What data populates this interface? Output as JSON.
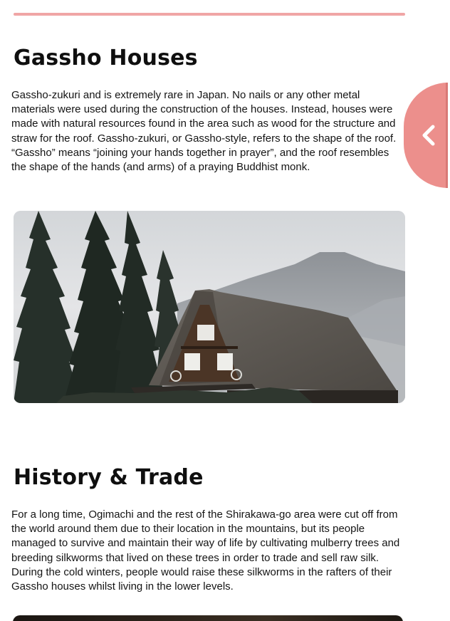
{
  "sections": [
    {
      "title": "Gassho Houses",
      "text": "Gassho-zukuri and is extremely rare in Japan. No nails or any other metal materials were used during the construction of the houses. Instead, houses were made with natural resources found in the area such as wood for the structure and straw for the roof. Gassho-zukuri, or Gassho-style, refers to the shape of the roof. “Gassho” means “joining your hands together in prayer”, and the roof resembles the shape of the hands (and arms) of a praying Buddhist monk."
    },
    {
      "title": "History & Trade",
      "text": "For a long time, Ogimachi and the rest of the Shirakawa-go area were cut off from the world around them due to their location in the mountains, but its people managed to survive and maintain their way of life by cultivating mulberry trees and breeding silkworms that lived on these trees in order to trade and sell raw silk. During the cold winters, people would raise these silkworms in the rafters of their Gassho houses whilst living in the lower levels."
    }
  ],
  "side_tab": {
    "icon": "chevron-left-icon"
  },
  "colors": {
    "accent": "#ec8f8c",
    "rule": "#f0a6a6",
    "text": "#141414"
  }
}
